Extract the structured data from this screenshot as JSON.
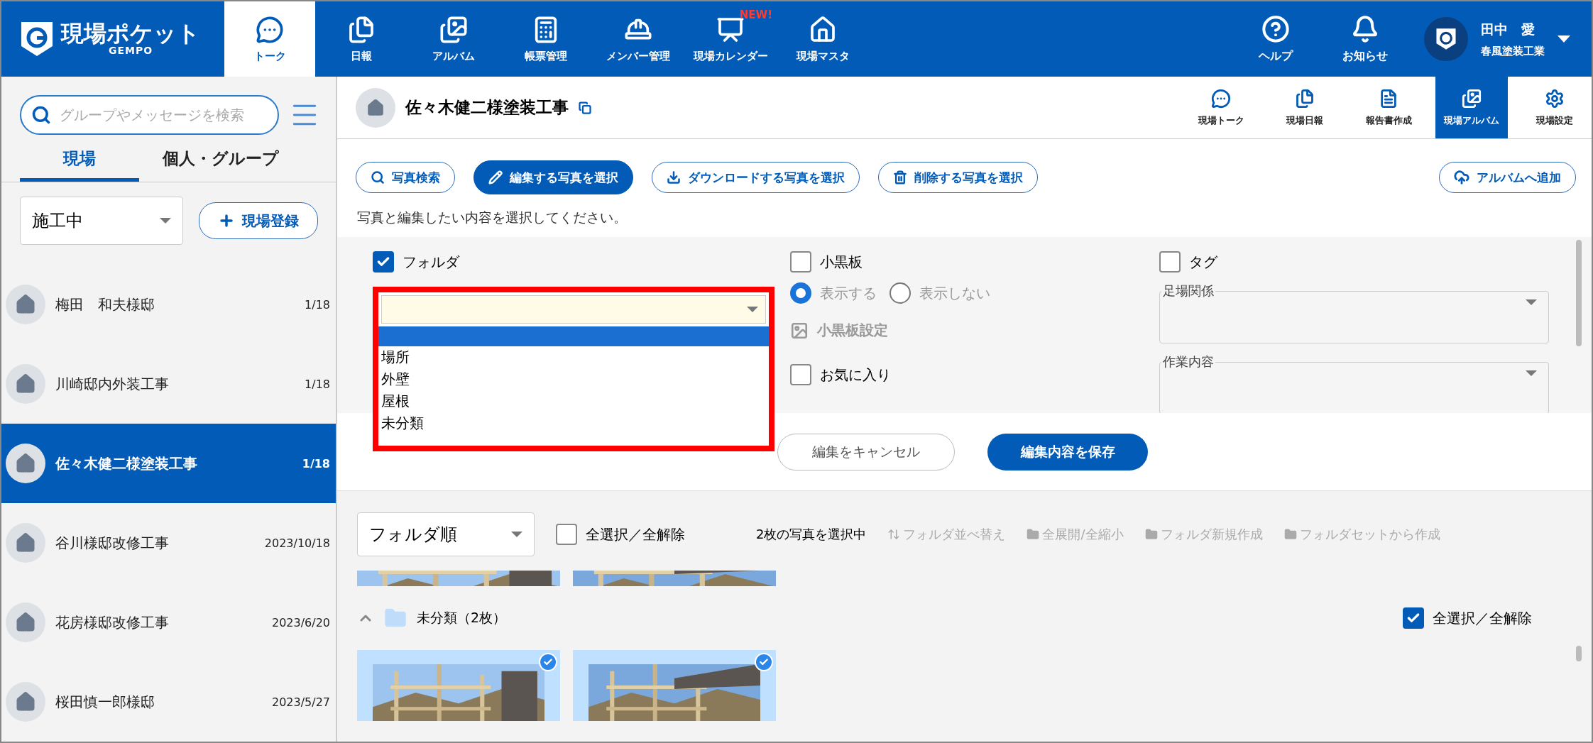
{
  "header": {
    "logo": {
      "title": "現場ポケット",
      "subtitle": "GEMPO"
    },
    "nav": [
      {
        "label": "トーク",
        "selected": true
      },
      {
        "label": "日報",
        "selected": false
      },
      {
        "label": "アルバム",
        "selected": false
      },
      {
        "label": "帳票管理",
        "selected": false
      },
      {
        "label": "メンバー管理",
        "selected": false
      },
      {
        "label": "現場カレンダー",
        "selected": false,
        "badge": "NEW!"
      },
      {
        "label": "現場マスタ",
        "selected": false
      }
    ],
    "utility": [
      {
        "label": "ヘルプ"
      },
      {
        "label": "お知らせ"
      }
    ],
    "user": {
      "name": "田中　愛",
      "company": "春風塗装工業"
    }
  },
  "sidebar": {
    "search": {
      "placeholder": "グループやメッセージを検索"
    },
    "tabs": [
      {
        "label": "現場",
        "selected": true
      },
      {
        "label": "個人・グループ",
        "selected": false
      }
    ],
    "filter": "施工中",
    "add_button": "現場登録",
    "sites": [
      {
        "name": "梅田　和夫様邸",
        "date": "1/18",
        "selected": false
      },
      {
        "name": "川崎邸内外装工事",
        "date": "1/18",
        "selected": false
      },
      {
        "name": "佐々木健二様塗装工事",
        "date": "1/18",
        "selected": true
      },
      {
        "name": "谷川様邸改修工事",
        "date": "2023/10/18",
        "selected": false
      },
      {
        "name": "花房様邸改修工事",
        "date": "2023/6/20",
        "selected": false
      },
      {
        "name": "桜田慎一郎様邸",
        "date": "2023/5/27",
        "selected": false
      }
    ]
  },
  "project": {
    "title": "佐々木健二様塗装工事",
    "tabs": [
      {
        "label": "現場トーク",
        "selected": false
      },
      {
        "label": "現場日報",
        "selected": false
      },
      {
        "label": "報告書作成",
        "selected": false
      },
      {
        "label": "現場アルバム",
        "selected": true
      },
      {
        "label": "現場設定",
        "selected": false
      }
    ]
  },
  "toolbar": {
    "buttons": [
      {
        "label": "写真検索",
        "selected": false
      },
      {
        "label": "編集する写真を選択",
        "selected": true
      },
      {
        "label": "ダウンロードする写真を選択",
        "selected": false
      },
      {
        "label": "削除する写真を選択",
        "selected": false
      }
    ],
    "add_album": "アルバムへ追加"
  },
  "instruction": "写真と編集したい内容を選択してください。",
  "edit_panel": {
    "folder": {
      "label": "フォルダ",
      "checked": true,
      "blank_option_highlighted": true,
      "options": [
        "場所",
        "外壁",
        "屋根",
        "未分類"
      ]
    },
    "board": {
      "label": "小黒板",
      "checked": false,
      "display_options": [
        {
          "label": "表示する",
          "selected": true
        },
        {
          "label": "表示しない",
          "selected": false
        }
      ],
      "settings_link": "小黒板設定"
    },
    "favorite": {
      "label": "お気に入り",
      "checked": false
    },
    "tag": {
      "label": "タグ",
      "checked": false,
      "fields": [
        {
          "label": "足場関係"
        },
        {
          "label": "作業内容"
        }
      ]
    },
    "cancel": "編集をキャンセル",
    "save": "編集内容を保存"
  },
  "album": {
    "sort": "フォルダ順",
    "select_all": {
      "label": "全選択／全解除",
      "checked": false
    },
    "count": "2枚の写真を選択中",
    "tools": [
      {
        "label": "フォルダ並べ替え"
      },
      {
        "label": "全展開/全縮小"
      },
      {
        "label": "フォルダ新規作成"
      },
      {
        "label": "フォルダセットから作成"
      }
    ],
    "upper_photos": [
      {
        "kind": "picture"
      },
      {
        "kind": "picture"
      }
    ],
    "folder": {
      "name": "未分類（2枚）",
      "expanded": true,
      "select_all": {
        "label": "全選択／全解除",
        "checked": true
      },
      "photos": [
        {
          "kind": "picture",
          "checked": true
        },
        {
          "kind": "picture",
          "checked": true
        }
      ]
    }
  }
}
